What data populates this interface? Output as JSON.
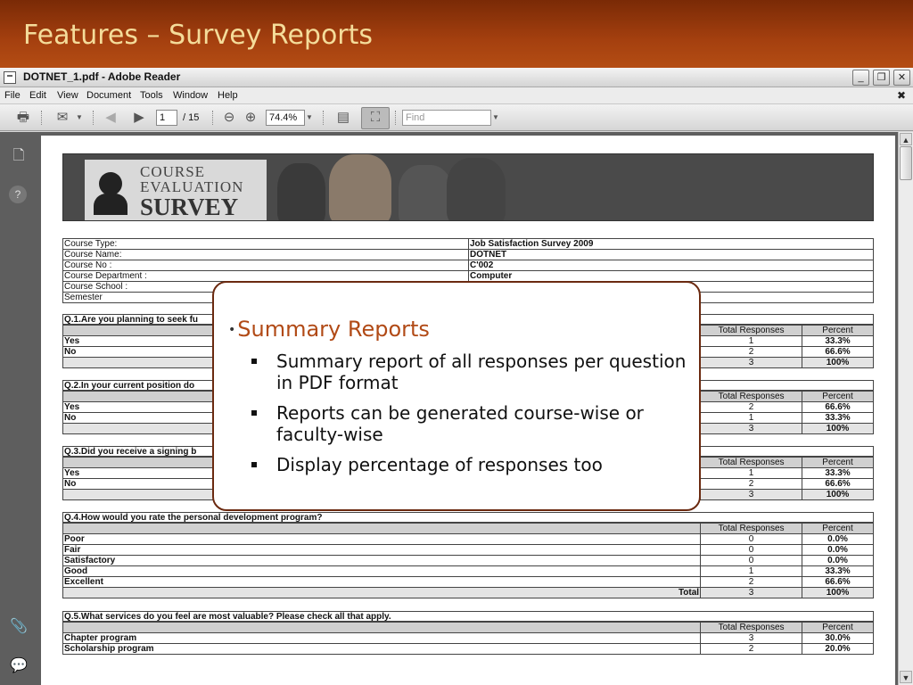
{
  "slide": {
    "title": "Features – Survey Reports"
  },
  "window": {
    "title": "DOTNET_1.pdf - Adobe Reader",
    "minimize": "_",
    "restore": "❐",
    "close": "✕"
  },
  "menu": [
    "File",
    "Edit",
    "View",
    "Document",
    "Tools",
    "Window",
    "Help"
  ],
  "menu_close": "✖",
  "toolbar": {
    "page_current": "1",
    "page_total": "/ 15",
    "zoom": "74.4%",
    "find_placeholder": "Find"
  },
  "survey": {
    "logo_line1": "COURSE",
    "logo_line2": "EVALUATION",
    "logo_line3": "SURVEY",
    "info": [
      {
        "label": "Course Type:",
        "value": "Job Satisfaction Survey 2009"
      },
      {
        "label": "Course Name:",
        "value": "DOTNET"
      },
      {
        "label": "Course No :",
        "value": "C'002"
      },
      {
        "label": "Course Department :",
        "value": "Computer"
      },
      {
        "label": "Course School :",
        "value": ""
      },
      {
        "label": "Semester",
        "value": ""
      }
    ],
    "header_total": "Total Responses",
    "header_percent": "Percent",
    "total_label": "Total",
    "questions": [
      {
        "title": "Q.1.Are you planning to seek fu",
        "rows": [
          [
            "Yes",
            "1",
            "33.3%"
          ],
          [
            "No",
            "2",
            "66.6%"
          ]
        ],
        "total": [
          "3",
          "100%"
        ]
      },
      {
        "title": "Q.2.In your current position do",
        "rows": [
          [
            "Yes",
            "2",
            "66.6%"
          ],
          [
            "No",
            "1",
            "33.3%"
          ]
        ],
        "total": [
          "3",
          "100%"
        ]
      },
      {
        "title": "Q.3.Did you receive a signing b",
        "rows": [
          [
            "Yes",
            "1",
            "33.3%"
          ],
          [
            "No",
            "2",
            "66.6%"
          ]
        ],
        "total": [
          "3",
          "100%"
        ]
      },
      {
        "title": "Q.4.How would you rate the personal development program?",
        "rows": [
          [
            "Poor",
            "0",
            "0.0%"
          ],
          [
            "Fair",
            "0",
            "0.0%"
          ],
          [
            "Satisfactory",
            "0",
            "0.0%"
          ],
          [
            "Good",
            "1",
            "33.3%"
          ],
          [
            "Excellent",
            "2",
            "66.6%"
          ]
        ],
        "total": [
          "3",
          "100%"
        ]
      },
      {
        "title": "Q.5.What services do you feel are most valuable? Please check all that apply.",
        "rows": [
          [
            "Chapter program",
            "3",
            "30.0%"
          ],
          [
            "Scholarship program",
            "2",
            "20.0%"
          ]
        ]
      }
    ]
  },
  "callout": {
    "heading": "Summary Reports",
    "bullets": [
      "Summary report of all responses per question in PDF format",
      "Reports can be generated course-wise or faculty-wise",
      "Display  percentage of responses too"
    ]
  }
}
